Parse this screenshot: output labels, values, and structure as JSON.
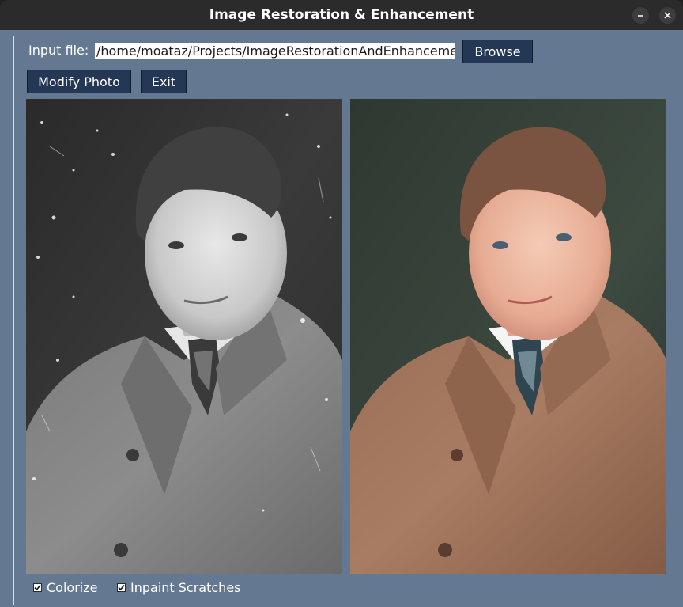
{
  "window": {
    "title": "Image Restoration & Enhancement"
  },
  "form": {
    "input_label": "Input file:",
    "input_value": "/home/moataz/Projects/ImageRestorationAndEnhanceme",
    "browse_label": "Browse",
    "modify_label": "Modify Photo",
    "exit_label": "Exit"
  },
  "images": {
    "original": "original-bw-portrait",
    "restored": "restored-color-portrait"
  },
  "options": {
    "colorize_label": "Colorize",
    "colorize_checked": true,
    "inpaint_label": "Inpaint Scratches",
    "inpaint_checked": true
  },
  "colors": {
    "background": "#647891",
    "button": "#243856",
    "titlebar": "#2b2b2b"
  }
}
